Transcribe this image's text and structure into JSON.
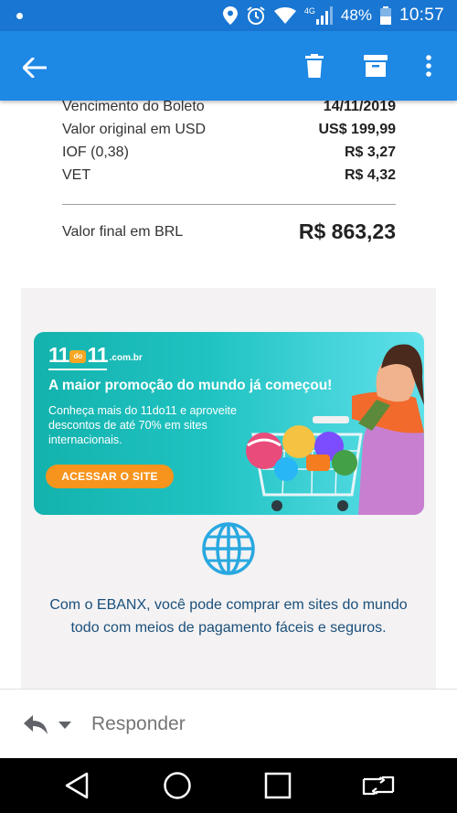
{
  "status_bar": {
    "network": "4G",
    "battery": "48%",
    "time": "10:57"
  },
  "app_bar": {
    "back_icon": "arrow-left-icon",
    "delete_icon": "trash-icon",
    "archive_icon": "archive-icon",
    "more_icon": "more-vertical-icon",
    "color": "#1e88e5"
  },
  "invoice": {
    "rows": [
      {
        "label": "Vencimento do Boleto",
        "value": "14/11/2019"
      },
      {
        "label": "Valor original em USD",
        "value": "US$ 199,99"
      },
      {
        "label": "IOF (0,38)",
        "value": "R$ 3,27"
      },
      {
        "label": "VET",
        "value": "R$ 4,32"
      }
    ],
    "total_label": "Valor final em BRL",
    "total_value": "R$ 863,23"
  },
  "promo": {
    "logo_main": "11",
    "logo_do": "do",
    "logo_end": "11",
    "logo_domain": ".com.br",
    "headline": "A maior promoção do mundo já começou!",
    "description": "Conheça mais do 11do11 e aproveite descontos de até 70% em sites internacionais.",
    "cta": "ACESSAR O SITE",
    "cta_color": "#f7941d"
  },
  "ebanx": {
    "icon": "globe-icon",
    "text": "Com o EBANX, você pode comprar em sites do mundo todo com meios de pagamento fáceis e seguros."
  },
  "reply_bar": {
    "reply_icon": "reply-icon",
    "label": "Responder"
  }
}
